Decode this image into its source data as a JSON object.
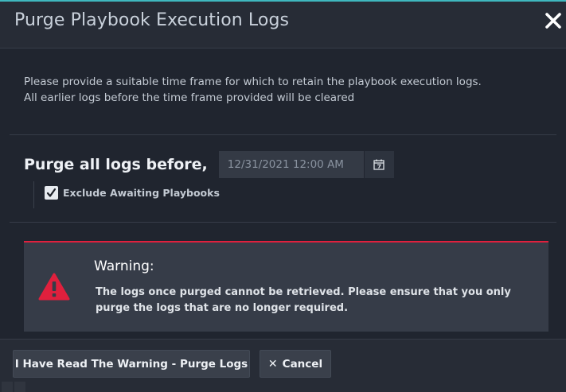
{
  "modal": {
    "title": "Purge Playbook Execution Logs",
    "close_icon": "close-icon",
    "accent_color": "#3fb8bf"
  },
  "intro": {
    "line1": "Please provide a suitable time frame for which to retain the playbook execution logs.",
    "line2": "All earlier logs before the time frame provided will be cleared"
  },
  "purge": {
    "label": "Purge all logs before,",
    "date_value": "12/31/2021 12:00 AM",
    "calendar_icon": "calendar-icon",
    "exclude_label": "Exclude Awaiting Playbooks",
    "exclude_checked": true
  },
  "warning": {
    "title": "Warning:",
    "text": "The logs once purged cannot be retrieved. Please ensure that you only purge the logs that are no longer required.",
    "color": "#e0203d",
    "icon": "warning-icon"
  },
  "footer": {
    "purge_label": "I Have Read The Warning - Purge Logs",
    "cancel_label": "Cancel",
    "cancel_icon": "times-icon"
  }
}
